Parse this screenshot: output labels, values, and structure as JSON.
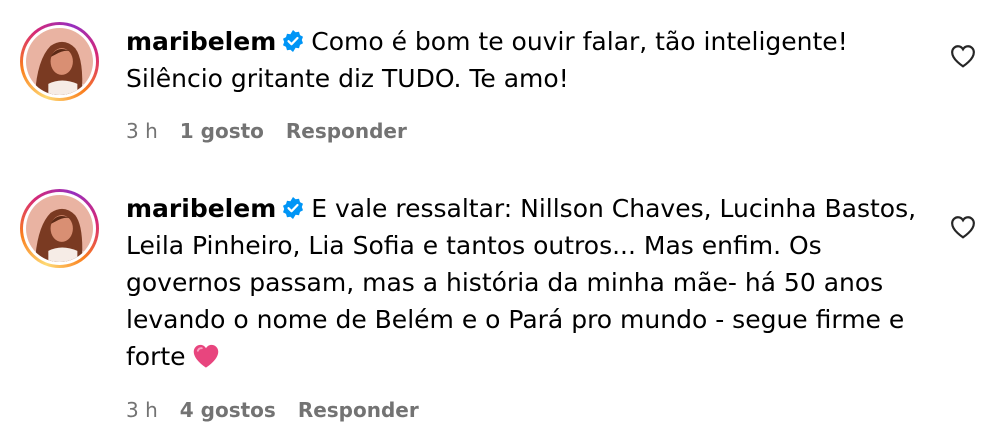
{
  "comments": [
    {
      "username": "maribelem",
      "text": "Como é bom te ouvir falar, tão inteligente! Silêncio gritante diz TUDO. Te amo!",
      "time": "3 h",
      "likes": "1 gosto",
      "reply": "Responder",
      "verified_icon": "verified-badge-icon",
      "like_icon": "heart-outline-icon"
    },
    {
      "username": "maribelem",
      "text": "E vale ressaltar: Nillson Chaves, Lucinha Bastos, Leila Pinheiro, Lia Sofia e tantos outros... Mas enfim. Os governos passam, mas a história da minha mãe- há 50 anos levando o nome de Belém e o Pará pro mundo - segue firme e forte",
      "emoji": "pink-heart-emoji",
      "time": "3 h",
      "likes": "4 gostos",
      "reply": "Responder",
      "verified_icon": "verified-badge-icon",
      "like_icon": "heart-outline-icon"
    }
  ],
  "colors": {
    "verified": "#0095f6",
    "meta_text": "#737373",
    "heart_emoji": "#e8457e"
  }
}
